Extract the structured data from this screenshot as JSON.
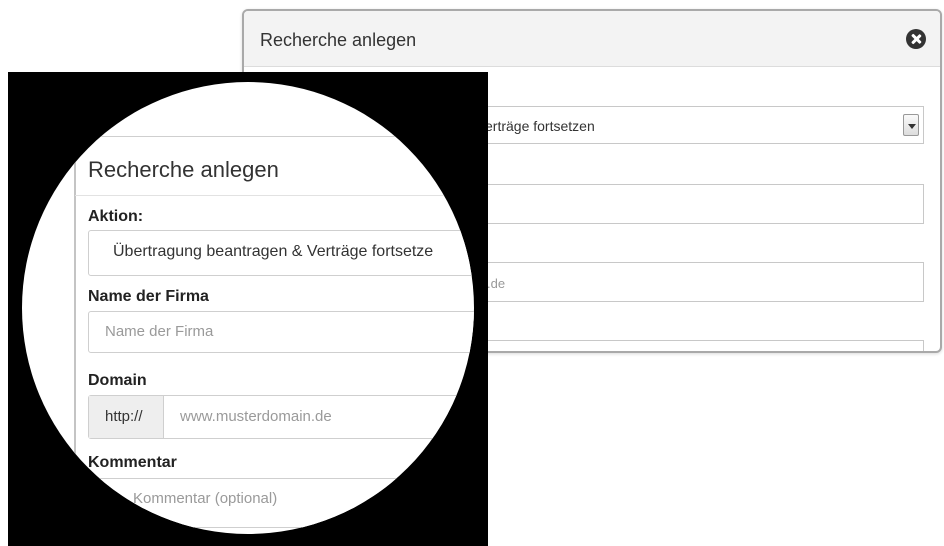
{
  "background_dialog": {
    "title": "Recherche anlegen",
    "select_value": "erträge fortsetzen",
    "domain_value": ".de"
  },
  "zoom": {
    "title": "Recherche anlegen",
    "action_label": "Aktion:",
    "action_value": "Übertragung beantragen & Verträge fortsetze",
    "company_label": "Name der Firma",
    "company_placeholder": "Name der Firma",
    "domain_label": "Domain",
    "domain_prefix": "http://",
    "domain_placeholder": "www.musterdomain.de",
    "comment_label": "Kommentar",
    "comment_placeholder": "Kommentar (optional)"
  },
  "icons": {
    "close": "close-icon",
    "dropdown": "chevron-down-icon"
  },
  "colors": {
    "lens_border": "#000000",
    "header_bg": "#f3f3f3",
    "input_border": "#cfcfcf",
    "addon_bg": "#eeeeee"
  }
}
